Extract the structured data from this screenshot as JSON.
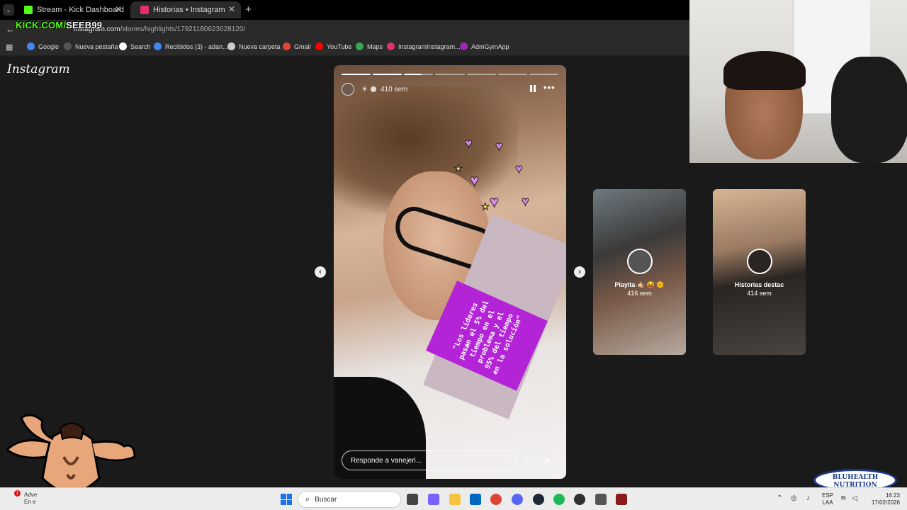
{
  "browser": {
    "tabs": [
      {
        "title": "Stream - Kick Dashboard",
        "active": false,
        "favicon_color": "#53fc18"
      },
      {
        "title": "Historias • Instagram",
        "active": true,
        "favicon_color": "#e1306c"
      }
    ],
    "stream_overlay": {
      "prefix": "KICK.COM/",
      "handle": "SEEB99"
    },
    "url": {
      "host": "instagram.com",
      "path": "/stories/highlights/17921180623028120/"
    },
    "bookmarks": [
      {
        "label": "Google",
        "icon": "google-icon",
        "color": "#4285f4"
      },
      {
        "label": "Nueva pestaña",
        "icon": "page-icon",
        "color": "#555555"
      },
      {
        "label": "Search",
        "icon": "search-icon",
        "color": "#ffffff"
      },
      {
        "label": "Recibidos (3) - adan...",
        "icon": "google-icon",
        "color": "#4285f4"
      },
      {
        "label": "Nueva carpeta",
        "icon": "folder-icon",
        "color": "#cccccc"
      },
      {
        "label": "Gmail",
        "icon": "gmail-icon",
        "color": "#ea4335"
      },
      {
        "label": "YouTube",
        "icon": "youtube-icon",
        "color": "#ff0000"
      },
      {
        "label": "Maps",
        "icon": "maps-icon",
        "color": "#34a853"
      },
      {
        "label": "InstagramInstagram...",
        "icon": "instagram-icon",
        "color": "#e1306c"
      },
      {
        "label": "AdmGymApp",
        "icon": "app-icon",
        "color": "#9c27b0"
      }
    ]
  },
  "instagram": {
    "logo": "Instagram",
    "story": {
      "time": "410 sem",
      "emoji": "☀",
      "sticker_text": "\"Los líderes pasan el 5% del tiempo en el problema y el 95% del tiempo en la solución\"",
      "reply_placeholder": "Responde a vanejeri...",
      "segments_done": 2,
      "segments_total": 7
    },
    "previews": [
      {
        "name": "Playita 🤙🏼 😝 🌞",
        "time": "416 sem"
      },
      {
        "name": "Historias destac",
        "time": "414 sem"
      }
    ]
  },
  "brand": {
    "line1": "BLUHEALTH",
    "line2": "NUTRITION"
  },
  "taskbar": {
    "notification": {
      "count": "1",
      "line1": "Adve",
      "line2": "En e"
    },
    "search_placeholder": "Buscar",
    "language": {
      "line1": "ESP",
      "line2": "LAA"
    },
    "clock": {
      "time": "16:23",
      "date": "17/02/2026"
    }
  }
}
